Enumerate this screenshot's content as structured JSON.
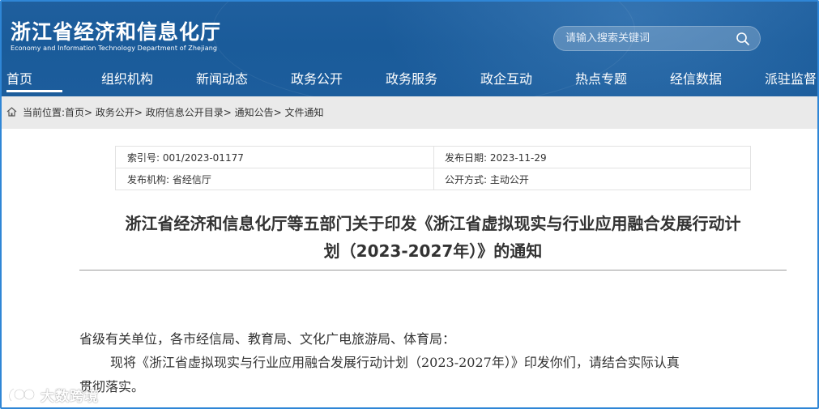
{
  "header": {
    "title": "浙江省经济和信息化厅",
    "subtitle": "Economy and Information Technology Department of Zhejiang",
    "search_placeholder": "请输入搜索关键词"
  },
  "nav": {
    "items": [
      {
        "label": "首页",
        "active": true
      },
      {
        "label": "组织机构"
      },
      {
        "label": "新闻动态"
      },
      {
        "label": "政务公开"
      },
      {
        "label": "政务服务"
      },
      {
        "label": "政企互动"
      },
      {
        "label": "热点专题"
      },
      {
        "label": "经信数据"
      },
      {
        "label": "派驻监督"
      }
    ]
  },
  "breadcrumb": "当前位置:首页> 政务公开> 政府信息公开目录> 通知公告> 文件通知",
  "info": {
    "index_no": "索引号: 001/2023-01177",
    "publish_date": "发布日期: 2023-11-29",
    "publisher": "发布机构: 省经信厅",
    "disclosure": "公开方式: 主动公开"
  },
  "document": {
    "title_line1": "浙江省经济和信息化厅等五部门关于印发《浙江省虚拟现实与行业应用融合发展行动计",
    "title_line2": "划（2023-2027年）》的通知",
    "salutation": "省级有关单位，各市经信局、教育局、文化广电旅游局、体育局：",
    "body_line1": "现将《浙江省虚拟现实与行业应用融合发展行动计划（2023-2027年）》印发你们，请结合实际认真",
    "body_line2": "贯彻落实。"
  },
  "watermark": "大数跨境",
  "colors": {
    "header_bg": "#1c5d9c",
    "frame_border": "#2f86d6",
    "breadcrumb_bg": "#eaeaea"
  }
}
